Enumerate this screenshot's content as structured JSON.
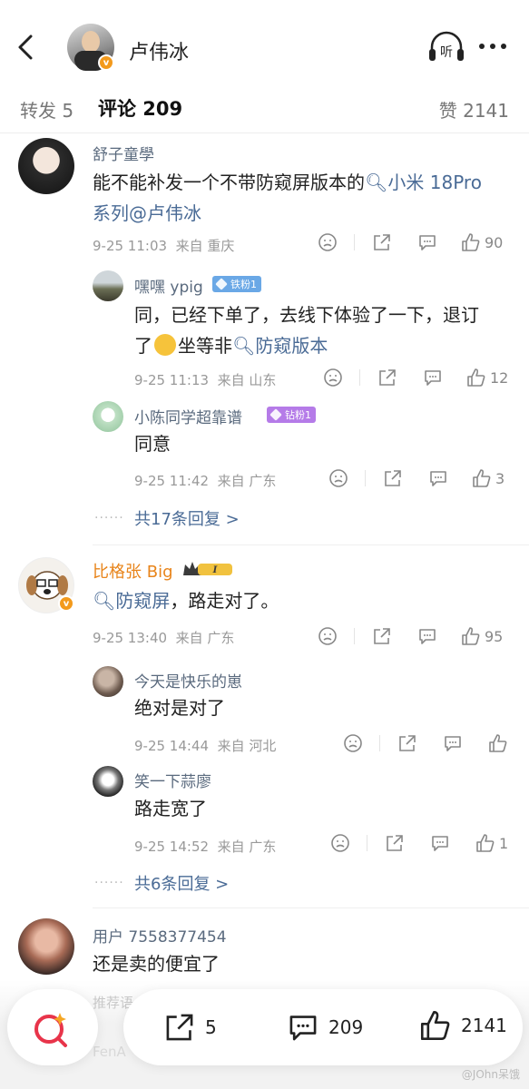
{
  "header": {
    "author_name": "卢伟冰",
    "listen_label": "听"
  },
  "tabs": {
    "repost": "转发 5",
    "comments": "评论 209",
    "likes": "赞 2141"
  },
  "comments": [
    {
      "name": "舒子童學",
      "text_line1_a": "能不能补发一个不带防窥屏版本的",
      "text_line1_link": "小米 18Pro",
      "text_line2_link": "系列",
      "text_line2_mention": "@卢伟冰",
      "time": "9-25 11:03",
      "location": "来自 重庆",
      "likes": "90",
      "replies": [
        {
          "name": "嘿嘿 ypig",
          "badge": "铁粉1",
          "badge_color": "#6aa8e6",
          "line1": "同，已经下单了，去线下体验了一下，退订",
          "line2_a": "了",
          "line2_b": "坐等非",
          "line2_link": "防窥版本",
          "time": "9-25 11:13",
          "location": "来自 山东",
          "likes": "12"
        },
        {
          "name": "小陈同学超靠谱",
          "badge": "钻粉1",
          "badge_color": "#b57be8",
          "line1": "同意",
          "time": "9-25 11:42",
          "location": "来自 广东",
          "likes": "3"
        }
      ],
      "more_replies": "共17条回复 >"
    },
    {
      "name": "比格张 Big",
      "text_link": "防窥屏",
      "text_rest": "，路走对了。",
      "time": "9-25 13:40",
      "location": "来自 广东",
      "likes": "95",
      "replies": [
        {
          "name": "今天是快乐的崽",
          "line1": "绝对是对了",
          "time": "9-25 14:44",
          "location": "来自 河北",
          "likes": ""
        },
        {
          "name": "笑一下蒜廖",
          "line1": "路走宽了",
          "time": "9-25 14:52",
          "location": "来自 广东",
          "likes": "1"
        }
      ],
      "more_replies": "共6条回复 >"
    },
    {
      "name": "用户 7558377454",
      "text": "还是卖的便宜了"
    }
  ],
  "bottom": {
    "hint": "推荐语",
    "hint2": "FenA",
    "repost_count": "5",
    "comment_count": "209",
    "like_count": "2141"
  },
  "watermark": "@JOhn呆饿",
  "colors": {
    "link": "#4a6b96",
    "orange_name": "#e8841a",
    "verified": "#f39a1c"
  }
}
